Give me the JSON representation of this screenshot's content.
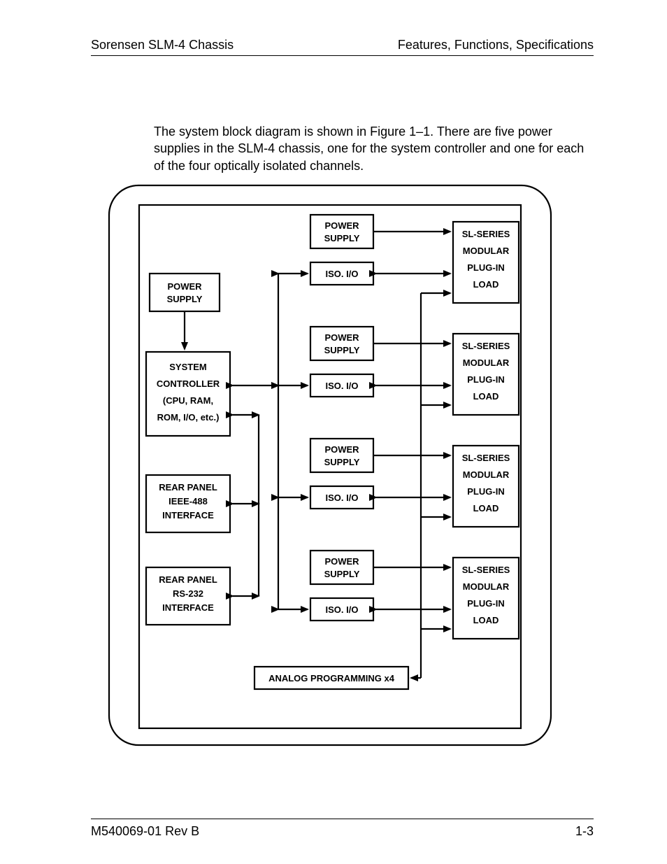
{
  "header": {
    "left": "Sorensen SLM-4 Chassis",
    "right": "Features, Functions, Specifications"
  },
  "body": {
    "paragraph": "The system block diagram is shown in Figure 1–1. There are five power supplies in the SLM-4 chassis, one for the system controller and one for each of the four optically isolated channels."
  },
  "diagram": {
    "left_col": {
      "power_supply": "POWER SUPPLY",
      "system_controller_lines": [
        "SYSTEM",
        "CONTROLLER",
        "(CPU, RAM,",
        "ROM, I/O, etc.)"
      ],
      "rear_ieee_lines": [
        "REAR PANEL",
        "IEEE-488",
        "INTERFACE"
      ],
      "rear_rs232_lines": [
        "REAR PANEL",
        "RS-232",
        "INTERFACE"
      ]
    },
    "mid_col": {
      "power_supply": "POWER SUPPLY",
      "iso_io": "ISO. I/O",
      "analog_programming": "ANALOG PROGRAMMING x4"
    },
    "right_col": {
      "load_lines": [
        "SL-SERIES",
        "MODULAR",
        "PLUG-IN",
        "LOAD"
      ]
    }
  },
  "footer": {
    "left": "M540069-01 Rev B",
    "right": "1-3"
  }
}
